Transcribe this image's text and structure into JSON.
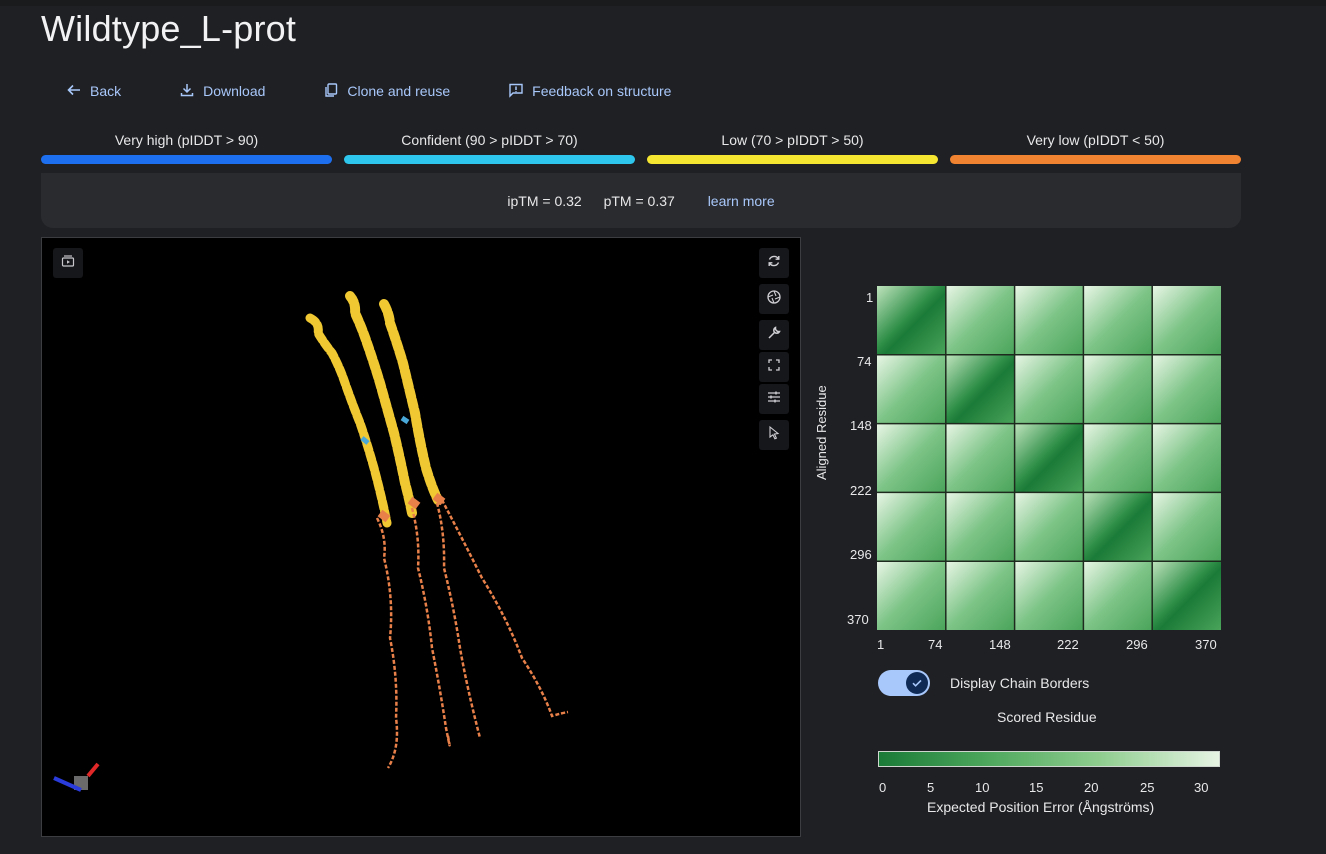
{
  "title": "Wildtype_L-prot",
  "toolbar": {
    "back": "Back",
    "download": "Download",
    "clone": "Clone and reuse",
    "feedback": "Feedback on structure"
  },
  "legend": [
    {
      "label": "Very high (pIDDT > 90)",
      "color": "#1e6ff0"
    },
    {
      "label": "Confident (90 > pIDDT > 70)",
      "color": "#2ec6ec"
    },
    {
      "label": "Low (70 > pIDDT > 50)",
      "color": "#f5e631"
    },
    {
      "label": "Very low (pIDDT < 50)",
      "color": "#ef8332"
    }
  ],
  "metrics": {
    "iptm": "ipTM = 0.32",
    "ptm": "pTM = 0.37",
    "learn_more": "learn more"
  },
  "pae": {
    "y_label": "Aligned Residue",
    "x_label": "Scored Residue",
    "ticks": [
      "1",
      "74",
      "148",
      "222",
      "296",
      "370"
    ],
    "toggle_label": "Display Chain Borders",
    "toggle_on": true,
    "colorbar_ticks": [
      "0",
      "5",
      "10",
      "15",
      "20",
      "25",
      "30"
    ],
    "colorbar_label": "Expected Position Error (Ångströms)"
  },
  "colors": {
    "link": "#a8c7fa",
    "helix": "#f0c832",
    "coil": "#e8804a"
  }
}
